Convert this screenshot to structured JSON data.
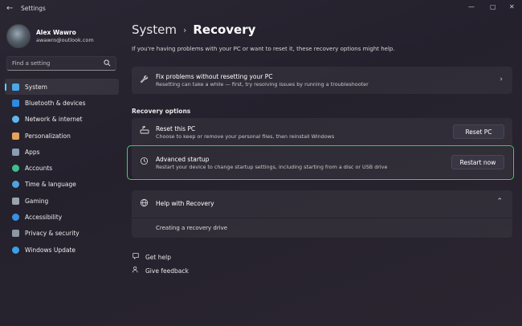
{
  "window": {
    "title": "Settings",
    "back_glyph": "←",
    "controls": {
      "minimize": "—",
      "maximize": "▢",
      "close": "✕"
    }
  },
  "profile": {
    "name": "Alex Wawro",
    "email": "awawro@outlook.com"
  },
  "search": {
    "placeholder": "Find a setting",
    "icon": "search-icon"
  },
  "sidebar": {
    "accent": "#60cdff",
    "items": [
      {
        "label": "System",
        "icon": "monitor-icon",
        "color": "#4aa8e8",
        "active": true
      },
      {
        "label": "Bluetooth & devices",
        "icon": "bluetooth-icon",
        "color": "#2f8ae0"
      },
      {
        "label": "Network & internet",
        "icon": "wifi-icon",
        "color": "#5fb6f0"
      },
      {
        "label": "Personalization",
        "icon": "brush-icon",
        "color": "#e4a25a"
      },
      {
        "label": "Apps",
        "icon": "apps-icon",
        "color": "#8a9cb3"
      },
      {
        "label": "Accounts",
        "icon": "person-icon",
        "color": "#3fbf8a"
      },
      {
        "label": "Time & language",
        "icon": "globe-clock-icon",
        "color": "#4fa3e0"
      },
      {
        "label": "Gaming",
        "icon": "gamepad-icon",
        "color": "#9aa3ad"
      },
      {
        "label": "Accessibility",
        "icon": "accessibility-icon",
        "color": "#3a8fe0"
      },
      {
        "label": "Privacy & security",
        "icon": "shield-icon",
        "color": "#8d96a3"
      },
      {
        "label": "Windows Update",
        "icon": "update-icon",
        "color": "#3aa0ea"
      }
    ]
  },
  "breadcrumb": {
    "parent": "System",
    "separator": "›",
    "current": "Recovery"
  },
  "intro": "If you're having problems with your PC or want to reset it, these recovery options might help.",
  "fix_card": {
    "title": "Fix problems without resetting your PC",
    "description": "Resetting can take a while — first, try resolving issues by running a troubleshooter",
    "icon": "wrench-icon"
  },
  "recovery_options": {
    "heading": "Recovery options",
    "reset": {
      "title": "Reset this PC",
      "description": "Choose to keep or remove your personal files, then reinstall Windows",
      "button": "Reset PC",
      "icon": "reset-pc-icon"
    },
    "advanced": {
      "title": "Advanced startup",
      "description": "Restart your device to change startup settings, including starting from a disc or USB drive",
      "button": "Restart now",
      "icon": "advanced-startup-icon",
      "highlight_color": "#3fcf6a"
    }
  },
  "help": {
    "title": "Help with Recovery",
    "link": "Creating a recovery drive",
    "icon": "globe-icon"
  },
  "footer_links": {
    "get_help": "Get help",
    "give_feedback": "Give feedback"
  }
}
